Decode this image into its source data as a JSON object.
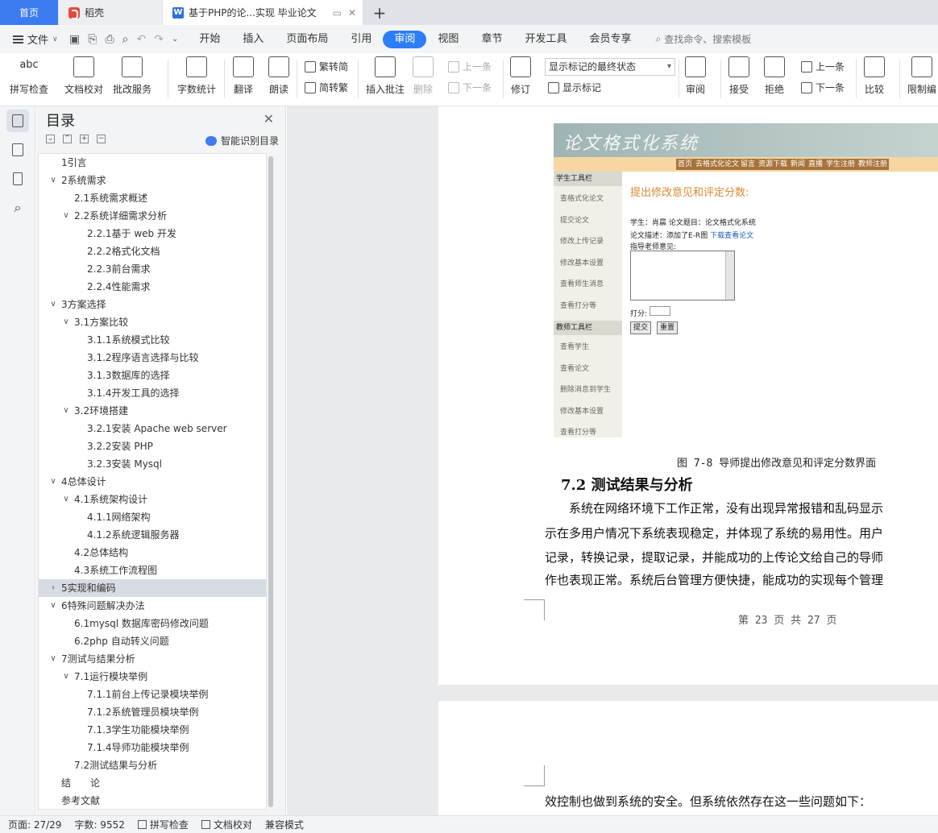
{
  "tabs": {
    "home": "首页",
    "daoke": "稻壳",
    "doc": "基于PHP的论...实现 毕业论文",
    "add": "+"
  },
  "menu": {
    "file": "文件",
    "tabs": [
      "开始",
      "插入",
      "页面布局",
      "引用",
      "审阅",
      "视图",
      "章节",
      "开发工具",
      "会员专享"
    ],
    "active_tab": "审阅",
    "search_placeholder": "查找命令、搜索模板"
  },
  "ribbon": {
    "spell_check": "拼写检查",
    "spell_icon_text": "abc",
    "doc_proof": "文档校对",
    "batch_service": "批改服务",
    "word_count": "字数统计",
    "translate": "翻译",
    "read_aloud": "朗读",
    "trad_to_simp": "繁转简",
    "simp_to_trad": "简转繁",
    "insert_comment": "插入批注",
    "delete": "删除",
    "prev": "上一条",
    "next": "下一条",
    "revise": "修订",
    "markup_state": "显示标记的最终状态",
    "show_markup": "显示标记",
    "review": "审阅",
    "accept": "接受",
    "reject": "拒绝",
    "prev2": "上一条",
    "next2": "下一条",
    "compare": "比较",
    "restrict": "限制编"
  },
  "toc": {
    "title": "目录",
    "smart": "智能识别目录",
    "items": [
      {
        "label": "1引言",
        "level": 1,
        "caret": ""
      },
      {
        "label": "2系统需求",
        "level": 1,
        "caret": "v"
      },
      {
        "label": "2.1系统需求概述",
        "level": 2,
        "caret": ""
      },
      {
        "label": "2.2系统详细需求分析",
        "level": 2,
        "caret": "v"
      },
      {
        "label": "2.2.1基于 web 开发",
        "level": 3,
        "caret": ""
      },
      {
        "label": "2.2.2格式化文档",
        "level": 3,
        "caret": ""
      },
      {
        "label": "2.2.3前台需求",
        "level": 3,
        "caret": ""
      },
      {
        "label": "2.2.4性能需求",
        "level": 3,
        "caret": ""
      },
      {
        "label": "3方案选择",
        "level": 1,
        "caret": "v"
      },
      {
        "label": "3.1方案比较",
        "level": 2,
        "caret": "v"
      },
      {
        "label": "3.1.1系统模式比较",
        "level": 3,
        "caret": ""
      },
      {
        "label": "3.1.2程序语言选择与比较",
        "level": 3,
        "caret": ""
      },
      {
        "label": "3.1.3数据库的选择",
        "level": 3,
        "caret": ""
      },
      {
        "label": "3.1.4开发工具的选择",
        "level": 3,
        "caret": ""
      },
      {
        "label": "3.2环境搭建",
        "level": 2,
        "caret": "v"
      },
      {
        "label": "3.2.1安装 Apache web server",
        "level": 3,
        "caret": ""
      },
      {
        "label": "3.2.2安装 PHP",
        "level": 3,
        "caret": ""
      },
      {
        "label": "3.2.3安装 Mysql",
        "level": 3,
        "caret": ""
      },
      {
        "label": "4总体设计",
        "level": 1,
        "caret": "v"
      },
      {
        "label": "4.1系统架构设计",
        "level": 2,
        "caret": "v"
      },
      {
        "label": "4.1.1网络架构",
        "level": 3,
        "caret": ""
      },
      {
        "label": "4.1.2系统逻辑服务器",
        "level": 3,
        "caret": ""
      },
      {
        "label": "4.2总体结构",
        "level": 2,
        "caret": ""
      },
      {
        "label": "4.3系统工作流程图",
        "level": 2,
        "caret": ""
      },
      {
        "label": "5实现和编码",
        "level": 1,
        "caret": ">",
        "selected": true
      },
      {
        "label": "6特殊问题解决办法",
        "level": 1,
        "caret": "v"
      },
      {
        "label": "6.1mysql 数据库密码修改问题",
        "level": 2,
        "caret": ""
      },
      {
        "label": "6.2php 自动转义问题",
        "level": 2,
        "caret": ""
      },
      {
        "label": "7测试与结果分析",
        "level": 1,
        "caret": "v"
      },
      {
        "label": "7.1运行模块举例",
        "level": 2,
        "caret": "v"
      },
      {
        "label": "7.1.1前台上传记录模块举例",
        "level": 3,
        "caret": ""
      },
      {
        "label": "7.1.2系统管理员模块举例",
        "level": 3,
        "caret": ""
      },
      {
        "label": "7.1.3学生功能模块举例",
        "level": 3,
        "caret": ""
      },
      {
        "label": "7.1.4导师功能模块举例",
        "level": 3,
        "caret": ""
      },
      {
        "label": "7.2测试结果与分析",
        "level": 2,
        "caret": ""
      },
      {
        "label": "结　　论",
        "level": 1,
        "caret": ""
      },
      {
        "label": "参考文献",
        "level": 1,
        "caret": ""
      }
    ]
  },
  "shot": {
    "title": "论文格式化系统",
    "nav": [
      "首页",
      "去格式化论文",
      "留言",
      "资源下载",
      "新闻",
      "直播",
      "学生注册",
      "教师注册"
    ],
    "side_head_student": "学生工具栏",
    "side_student": [
      "查格式化论文",
      "提交论文",
      "修改上传记录",
      "修改基本设置",
      "查看师生消息",
      "查看打分等"
    ],
    "side_head_teacher": "教师工具栏",
    "side_teacher": [
      "查看学生",
      "查看论文",
      "删除消息到学生",
      "修改基本设置",
      "查看打分等"
    ],
    "heading": "提出修改意见和评定分数:",
    "line1": "学生：肖晨 论文题目：论文格式化系统",
    "line2": "论文描述：添加了E-R图",
    "line2_link": "下载查看论文",
    "line3": "指导老师意见:",
    "score_label": "打分:",
    "btn_submit": "提交",
    "btn_reset": "重置"
  },
  "doc": {
    "caption": "图 7-8 导师提出修改意见和评定分数界面",
    "section": "7.2  测试结果与分析",
    "lines": [
      "　　系统在网络环境下工作正常，没有出现异常报错和乱码显示",
      "示在多用户情况下系统表现稳定，并体现了系统的易用性。用户",
      "记录，转换记录，提取记录，并能成功的上传论文给自己的导师",
      "作也表现正常。系统后台管理方便快捷，能成功的实现每个管理"
    ],
    "page_number": "第 23 页 共 27 页",
    "page2_line": "效控制也做到系统的安全。但系统依然存在这一些问题如下："
  },
  "status": {
    "page": "页面: 27/29",
    "words": "字数: 9552",
    "spell": "拼写检查",
    "proof": "文档校对",
    "compat": "兼容模式"
  },
  "colors": {
    "accent": "#2d7df6",
    "home_tab": "#3c7cf0",
    "toc_selected": "#d7dbe2"
  }
}
